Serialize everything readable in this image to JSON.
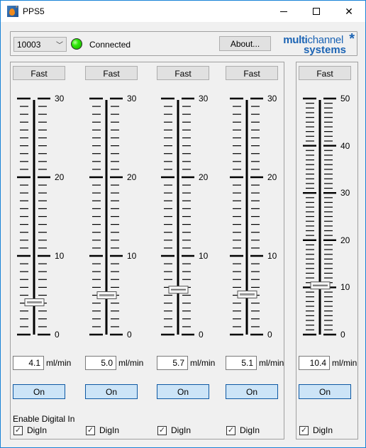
{
  "window": {
    "title": "PPS5",
    "controls": {
      "minimize": "minimize",
      "maximize": "maximize",
      "close": "close"
    }
  },
  "topbar": {
    "device_combo": {
      "selected": "10003"
    },
    "status_led": {
      "state": "connected",
      "color": "#2ee80a"
    },
    "status_text": "Connected",
    "about_label": "About...",
    "logo": {
      "line1_bold": "multi",
      "line1_rest": "channel",
      "line2": "systems",
      "mark": "*",
      "color": "#1c64b4"
    }
  },
  "channels": [
    {
      "fast_label": "Fast",
      "max": 30,
      "tick_labels": [
        "30",
        "20",
        "10",
        "0"
      ],
      "value": 4.1,
      "value_text": "4.1",
      "unit": "ml/min",
      "on_label": "On",
      "digin_label": "DigIn",
      "digin_checked": true
    },
    {
      "fast_label": "Fast",
      "max": 30,
      "tick_labels": [
        "30",
        "20",
        "10",
        "0"
      ],
      "value": 5.0,
      "value_text": "5.0",
      "unit": "ml/min",
      "on_label": "On",
      "digin_label": "DigIn",
      "digin_checked": true
    },
    {
      "fast_label": "Fast",
      "max": 30,
      "tick_labels": [
        "30",
        "20",
        "10",
        "0"
      ],
      "value": 5.7,
      "value_text": "5.7",
      "unit": "ml/min",
      "on_label": "On",
      "digin_label": "DigIn",
      "digin_checked": true
    },
    {
      "fast_label": "Fast",
      "max": 30,
      "tick_labels": [
        "30",
        "20",
        "10",
        "0"
      ],
      "value": 5.1,
      "value_text": "5.1",
      "unit": "ml/min",
      "on_label": "On",
      "digin_label": "DigIn",
      "digin_checked": true
    },
    {
      "fast_label": "Fast",
      "max": 50,
      "tick_labels": [
        "50",
        "40",
        "30",
        "20",
        "10",
        "0"
      ],
      "value": 10.4,
      "value_text": "10.4",
      "unit": "ml/min",
      "on_label": "On",
      "digin_label": "DigIn",
      "digin_checked": true
    }
  ],
  "enable_digital_in_label": "Enable Digital In",
  "check_glyph": "✓"
}
